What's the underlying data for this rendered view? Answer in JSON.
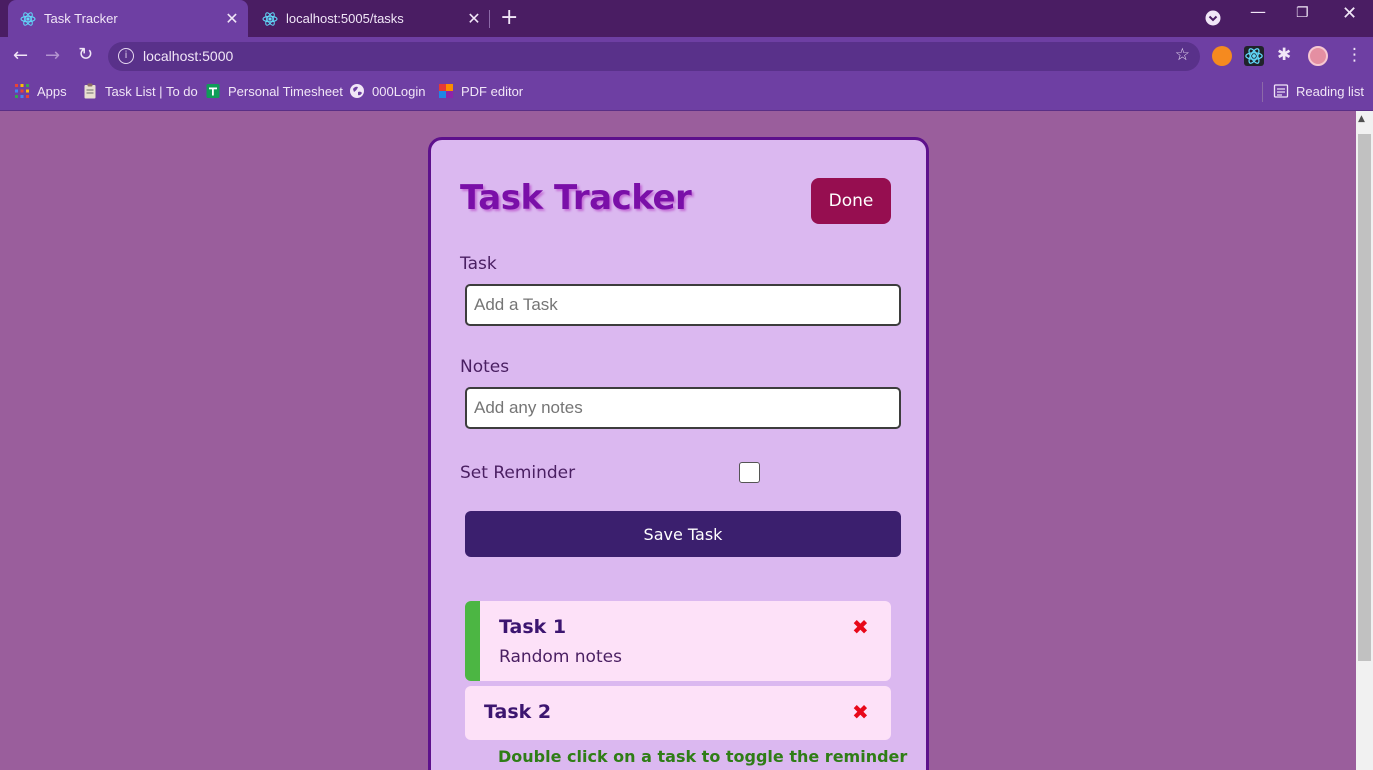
{
  "browser": {
    "tabs": [
      {
        "title": "Task Tracker",
        "active": true
      },
      {
        "title": "localhost:5005/tasks",
        "active": false
      }
    ],
    "new_tab": "+",
    "address": "localhost:5000",
    "bookmarks": [
      {
        "label": "Apps",
        "icon": "apps-grid-icon"
      },
      {
        "label": "Task List | To do",
        "icon": "clipboard-icon"
      },
      {
        "label": "Personal Timesheet",
        "icon": "sheets-icon"
      },
      {
        "label": "000Login",
        "icon": "globe-icon"
      },
      {
        "label": "PDF editor",
        "icon": "pdf-editor-icon"
      }
    ],
    "reading_list": "Reading list",
    "theme_color": "#6e3fa3"
  },
  "app": {
    "title": "Task Tracker",
    "header_button": "Done",
    "header_button_color": "#960e50",
    "form": {
      "task_label": "Task",
      "task_placeholder": "Add a Task",
      "notes_label": "Notes",
      "notes_placeholder": "Add any notes",
      "reminder_label": "Set Reminder",
      "reminder_checked": false,
      "save_button": "Save Task"
    },
    "tasks": [
      {
        "title": "Task 1",
        "notes": "Random notes",
        "reminder": true,
        "delete_icon": "close-x-icon"
      },
      {
        "title": "Task 2",
        "notes": "",
        "reminder": false,
        "delete_icon": "close-x-icon"
      }
    ],
    "hint": "Double click on a task to toggle the reminder",
    "reminder_color": "#4cb643"
  }
}
